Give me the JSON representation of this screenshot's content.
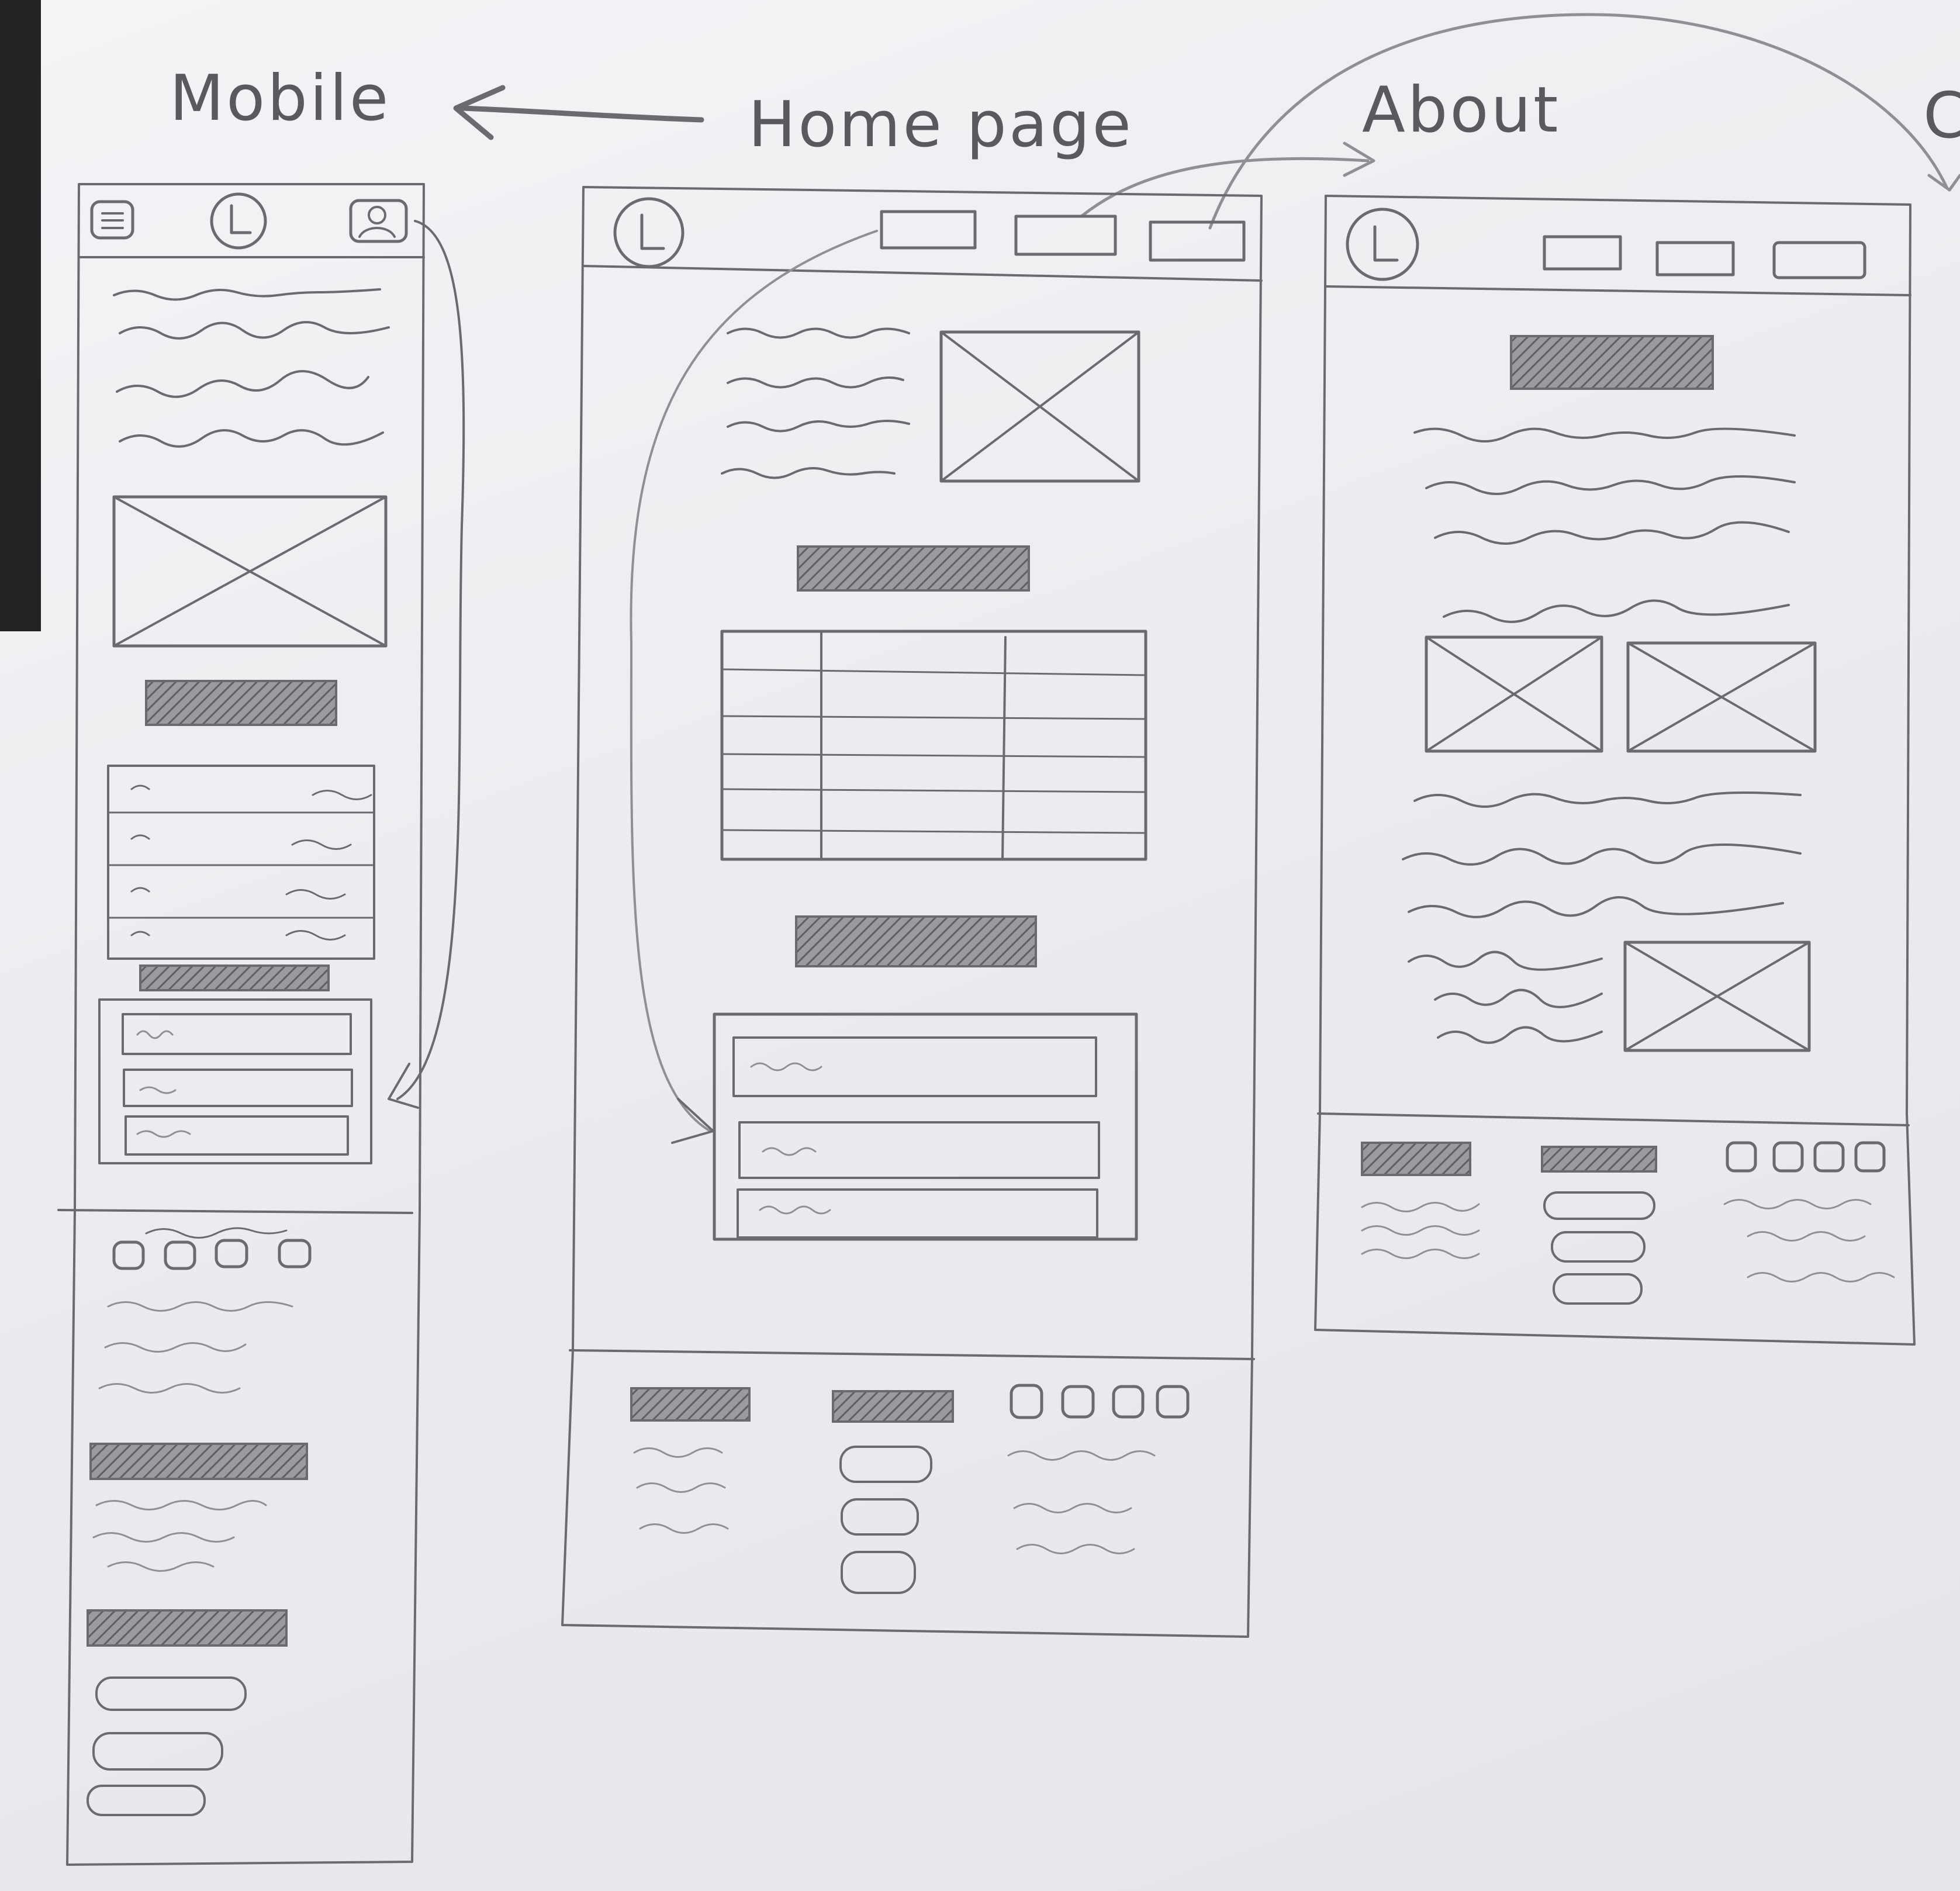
{
  "labels": {
    "mobile": "Mobile",
    "home": "Home page",
    "about": "About",
    "cut_off": "C"
  },
  "colors": {
    "paper": "#eeeef1",
    "pencil": "#6a6a70",
    "background": "#2c2c2c"
  },
  "wireframes": [
    {
      "page": "Mobile",
      "header_icons": [
        "hamburger-menu-icon",
        "logo-icon",
        "user-profile-icon"
      ],
      "blocks": [
        "text-lines",
        "image-placeholder",
        "heading-bar",
        "list-table",
        "heading-bar",
        "form-3-fields",
        "footer"
      ]
    },
    {
      "page": "Home page",
      "header_icons": [
        "logo-icon",
        "nav-button",
        "nav-button",
        "nav-button"
      ],
      "blocks": [
        "text-lines",
        "image-placeholder",
        "heading-bar",
        "table",
        "heading-bar",
        "form-3-fields",
        "footer"
      ]
    },
    {
      "page": "About",
      "header_icons": [
        "logo-icon",
        "nav-button",
        "nav-button",
        "nav-button"
      ],
      "blocks": [
        "heading-bar",
        "text-lines",
        "image-placeholder",
        "image-placeholder",
        "text-lines",
        "image-placeholder",
        "footer"
      ]
    }
  ]
}
